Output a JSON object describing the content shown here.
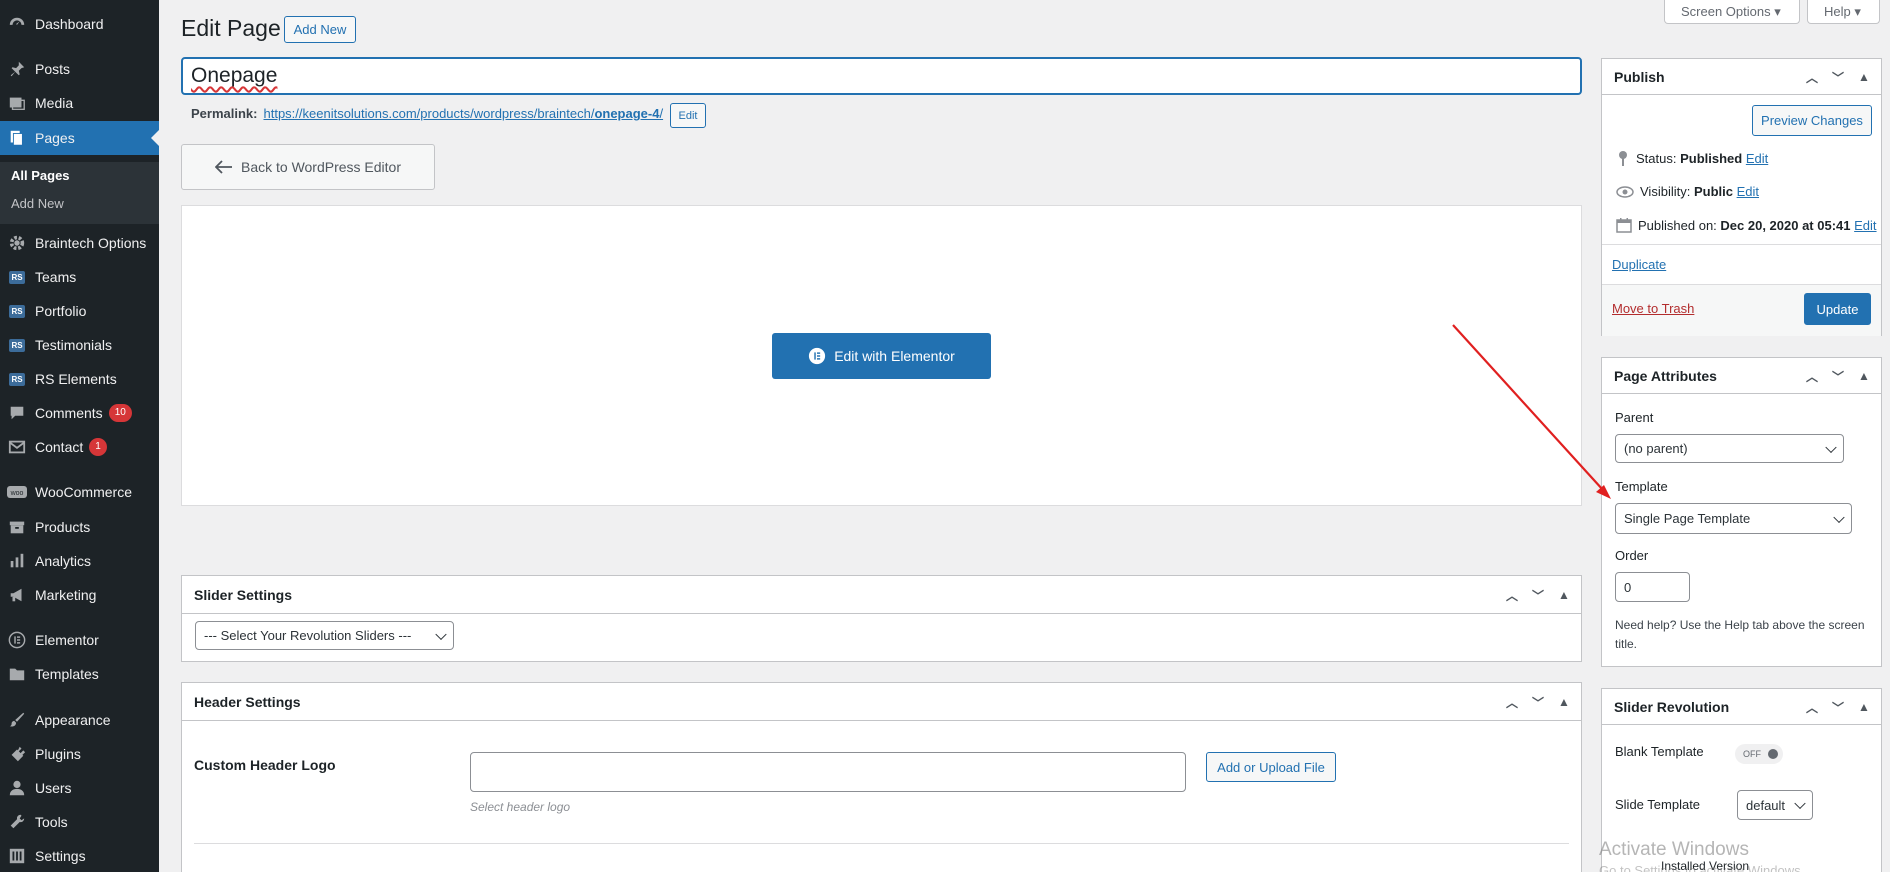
{
  "sidebar": {
    "items": [
      {
        "label": "Dashboard",
        "icon": "dashboard-icon"
      },
      {
        "label": "Posts",
        "icon": "pin-icon"
      },
      {
        "label": "Media",
        "icon": "media-icon"
      },
      {
        "label": "Pages",
        "icon": "pages-icon"
      },
      {
        "label": "Braintech Options",
        "icon": "gear-icon"
      },
      {
        "label": "Teams",
        "icon": "rs-icon"
      },
      {
        "label": "Portfolio",
        "icon": "rs-icon"
      },
      {
        "label": "Testimonials",
        "icon": "rs-icon"
      },
      {
        "label": "RS Elements",
        "icon": "rs-icon"
      },
      {
        "label": "Comments",
        "icon": "comment-icon",
        "badge": "10"
      },
      {
        "label": "Contact",
        "icon": "mail-icon",
        "badge": "1"
      },
      {
        "label": "WooCommerce",
        "icon": "woo-icon"
      },
      {
        "label": "Products",
        "icon": "archive-icon"
      },
      {
        "label": "Analytics",
        "icon": "chart-icon"
      },
      {
        "label": "Marketing",
        "icon": "megaphone-icon"
      },
      {
        "label": "Elementor",
        "icon": "elementor-icon"
      },
      {
        "label": "Templates",
        "icon": "folder-icon"
      },
      {
        "label": "Appearance",
        "icon": "brush-icon"
      },
      {
        "label": "Plugins",
        "icon": "plug-icon"
      },
      {
        "label": "Users",
        "icon": "user-icon"
      },
      {
        "label": "Tools",
        "icon": "wrench-icon"
      },
      {
        "label": "Settings",
        "icon": "settings-icon"
      }
    ],
    "rs_text": "RS",
    "submenu": [
      "All Pages",
      "Add New"
    ]
  },
  "header": {
    "title": "Edit Page",
    "add_new": "Add New",
    "screen_options": "Screen Options ▾",
    "help": "Help ▾"
  },
  "editor": {
    "post_title": "Onepage",
    "permalink_label": "Permalink:",
    "permalink_base": "https://keenitsolutions.com/products/wordpress/braintech/",
    "permalink_slug": "onepage-4",
    "permalink_end": "/",
    "permalink_edit": "Edit",
    "back_button": "Back to WordPress Editor",
    "elementor_button": "Edit with Elementor"
  },
  "slider_settings": {
    "title": "Slider Settings",
    "select_value": "--- Select Your Revolution Sliders ---"
  },
  "header_settings": {
    "title": "Header Settings",
    "field_label": "Custom Header Logo",
    "upload_button": "Add or Upload File",
    "hint": "Select header logo"
  },
  "publish": {
    "title": "Publish",
    "preview": "Preview Changes",
    "status_label": "Status:",
    "status_value": "Published",
    "visibility_label": "Visibility:",
    "visibility_value": "Public",
    "published_label": "Published on:",
    "published_value": "Dec 20, 2020 at 05:41",
    "edit": "Edit",
    "duplicate": "Duplicate",
    "trash": "Move to Trash",
    "update": "Update"
  },
  "page_attributes": {
    "title": "Page Attributes",
    "parent_label": "Parent",
    "parent_value": "(no parent)",
    "template_label": "Template",
    "template_value": "Single Page Template",
    "order_label": "Order",
    "order_value": "0",
    "help_text": "Need help? Use the Help tab above the screen title."
  },
  "slider_revolution": {
    "title": "Slider Revolution",
    "blank_label": "Blank Template",
    "blank_toggle": "OFF",
    "slide_label": "Slide Template",
    "slide_value": "default",
    "installed": "Installed Version"
  },
  "watermark": {
    "line1": "Activate Windows",
    "line2": "Go to Settings to activate Windows."
  },
  "colors": {
    "sidebar_bg": "#1d2327",
    "accent": "#2271b1",
    "badge": "#d63638",
    "annotation_arrow": "#e02020"
  }
}
